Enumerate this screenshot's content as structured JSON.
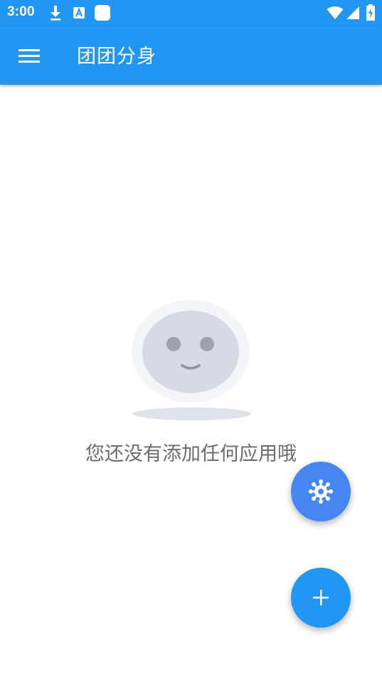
{
  "status_bar": {
    "time": "3:00",
    "icons": [
      "download-icon",
      "a-badge-icon",
      "app-square-icon",
      "wifi-icon",
      "cell-signal-icon",
      "battery-charging-icon"
    ]
  },
  "app_bar": {
    "title": "团团分身",
    "menu_icon": "hamburger-menu-icon",
    "color": "#2196f3"
  },
  "empty_state": {
    "illustration": "smiling-face-illustration",
    "message": "您还没有添加任何应用哦"
  },
  "fabs": {
    "settings": {
      "icon": "virus-gear-icon",
      "color": "#4586f0"
    },
    "add": {
      "icon": "plus-icon",
      "color": "#2196f3"
    }
  }
}
